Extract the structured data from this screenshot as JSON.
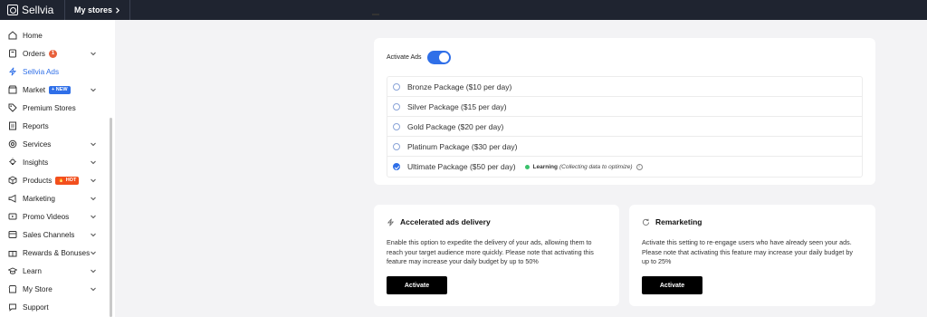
{
  "topbar": {
    "brand": "Sellvia",
    "my_stores": "My stores"
  },
  "sidebar": {
    "items": [
      {
        "label": "Home",
        "icon": "home-icon"
      },
      {
        "label": "Orders",
        "icon": "orders-icon",
        "badge": "1"
      },
      {
        "label": "Sellvia Ads",
        "icon": "bolt-icon"
      },
      {
        "label": "Market",
        "icon": "market-icon",
        "badge": "+ NEW"
      },
      {
        "label": "Premium Stores",
        "icon": "tag-icon"
      },
      {
        "label": "Reports",
        "icon": "reports-icon"
      },
      {
        "label": "Services",
        "icon": "services-icon"
      },
      {
        "label": "Insights",
        "icon": "lightbulb-icon"
      },
      {
        "label": "Products",
        "icon": "products-icon",
        "badge": "🔥 HOT"
      },
      {
        "label": "Marketing",
        "icon": "megaphone-icon"
      },
      {
        "label": "Promo Videos",
        "icon": "video-icon"
      },
      {
        "label": "Sales Channels",
        "icon": "channels-icon"
      },
      {
        "label": "Rewards & Bonuses",
        "icon": "gift-icon"
      },
      {
        "label": "Learn",
        "icon": "graduation-icon"
      },
      {
        "label": "My Store",
        "icon": "store-icon"
      },
      {
        "label": "Support",
        "icon": "chat-icon"
      }
    ]
  },
  "ads": {
    "activate_label": "Activate Ads",
    "activate_on": true,
    "packages": [
      {
        "label": "Bronze Package ($10 per day)",
        "selected": false
      },
      {
        "label": "Silver Package ($15 per day)",
        "selected": false
      },
      {
        "label": "Gold Package ($20 per day)",
        "selected": false
      },
      {
        "label": "Platinum Package ($30 per day)",
        "selected": false
      },
      {
        "label": "Ultimate Package ($50 per day)",
        "selected": true
      }
    ],
    "learning_label": "Learning",
    "learning_note": "(Collecting data to optimize)"
  },
  "accelerated": {
    "title": "Accelerated ads delivery",
    "description_lines": [
      "Enable this option to expedite the delivery of your ads, allowing them to",
      "reach your target audience more quickly. Please note that activating this",
      "feature may increase your daily budget by up to 50%"
    ],
    "button": "Activate"
  },
  "remarketing": {
    "title": "Remarketing",
    "description_lines": [
      "Activate this setting to re-engage users who have already seen your ads.",
      "Please note that activating this feature may increase your daily budget by",
      "up to 25%"
    ],
    "button": "Activate"
  },
  "colors": {
    "accent": "#2f6fe8",
    "topbar": "#1f2430",
    "learning_dot": "#3ac16b",
    "hot_badge": "#f24f1d",
    "count_badge": "#e8613c"
  }
}
